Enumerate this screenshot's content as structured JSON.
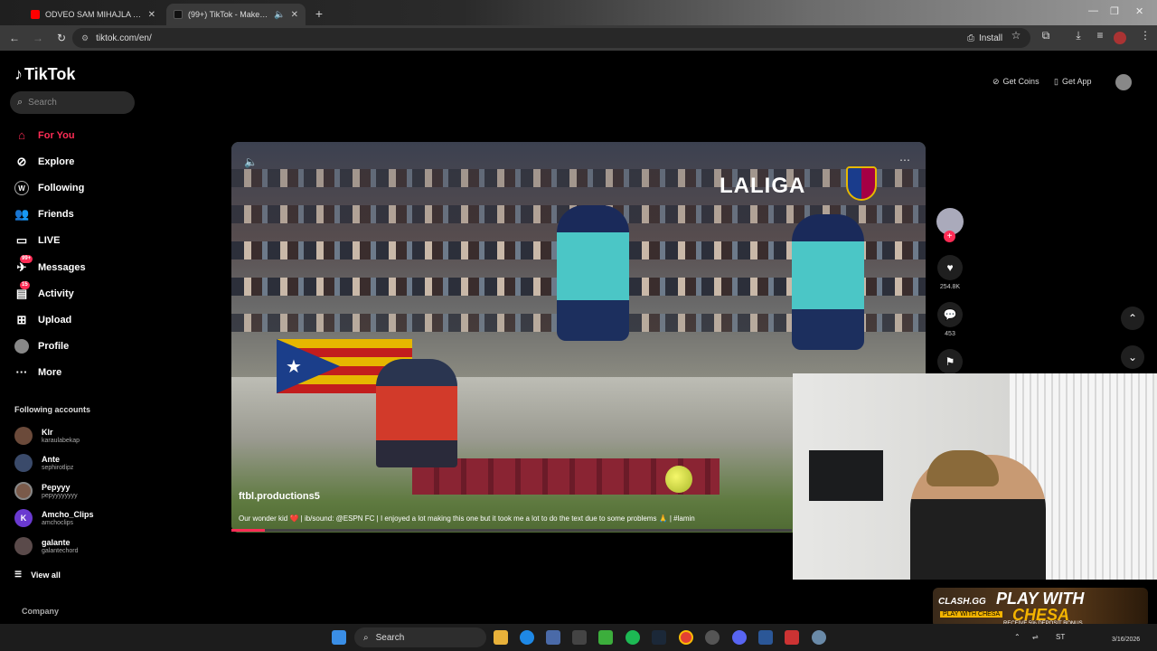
{
  "browser": {
    "tabs": [
      {
        "title": "ODVEO SAM MIHAJLA MADIĆ",
        "favicon_color": "#ff0000"
      },
      {
        "title": "(99+) TikTok - Make Your Day",
        "favicon_color": "#111111"
      }
    ],
    "url": "tiktok.com/en/",
    "install_label": "Install"
  },
  "tiktok": {
    "logo": "TikTok",
    "search_placeholder": "Search",
    "nav": [
      {
        "label": "For You",
        "icon": "home-icon",
        "active": true
      },
      {
        "label": "Explore",
        "icon": "compass-icon"
      },
      {
        "label": "Following",
        "icon": "following-icon"
      },
      {
        "label": "Friends",
        "icon": "friends-icon"
      },
      {
        "label": "LIVE",
        "icon": "live-icon"
      },
      {
        "label": "Messages",
        "icon": "messages-icon",
        "badge": "99+"
      },
      {
        "label": "Activity",
        "icon": "activity-icon",
        "badge": "15"
      },
      {
        "label": "Upload",
        "icon": "upload-icon"
      },
      {
        "label": "Profile",
        "icon": "profile-icon"
      },
      {
        "label": "More",
        "icon": "more-icon"
      }
    ],
    "following_header": "Following accounts",
    "accounts": [
      {
        "name": "Klr",
        "handle": "karaulabekap",
        "color": "#6b4a3a"
      },
      {
        "name": "Ante",
        "handle": "sephirotlipz",
        "color": "#3a4a6a"
      },
      {
        "name": "Pepyyy",
        "handle": "pepyyyyyyyy",
        "color": "#7a5a4a"
      },
      {
        "name": "Amcho_Clips",
        "handle": "amchoclips",
        "color": "#6a3ad0",
        "initial": "K"
      },
      {
        "name": "galante",
        "handle": "galantechord",
        "color": "#5a4a4a"
      }
    ],
    "view_all": "View all",
    "company": "Company",
    "get_coins": "Get Coins",
    "get_app": "Get App",
    "video": {
      "author": "ftbl.productions5",
      "description": "Our wonder kid ❤️ | ib/sound: @ESPN FC | I enjoyed a lot making this one but it took me a lot to do the text due to some problems 🙏 | #lamin",
      "overlay": "LALIGA",
      "likes": "254.8K",
      "comments": "453",
      "progress": 0.06
    }
  },
  "promo": {
    "brand": "CLASH.GG",
    "line1": "PLAY WITH",
    "line2": "CHESA",
    "sub": "RECEIVE 5% DEPOSIT BONUS",
    "tag": "PLAY WITH CHESA"
  },
  "taskbar": {
    "search": "Search",
    "lang": "ST",
    "date": "3/16/2026"
  }
}
